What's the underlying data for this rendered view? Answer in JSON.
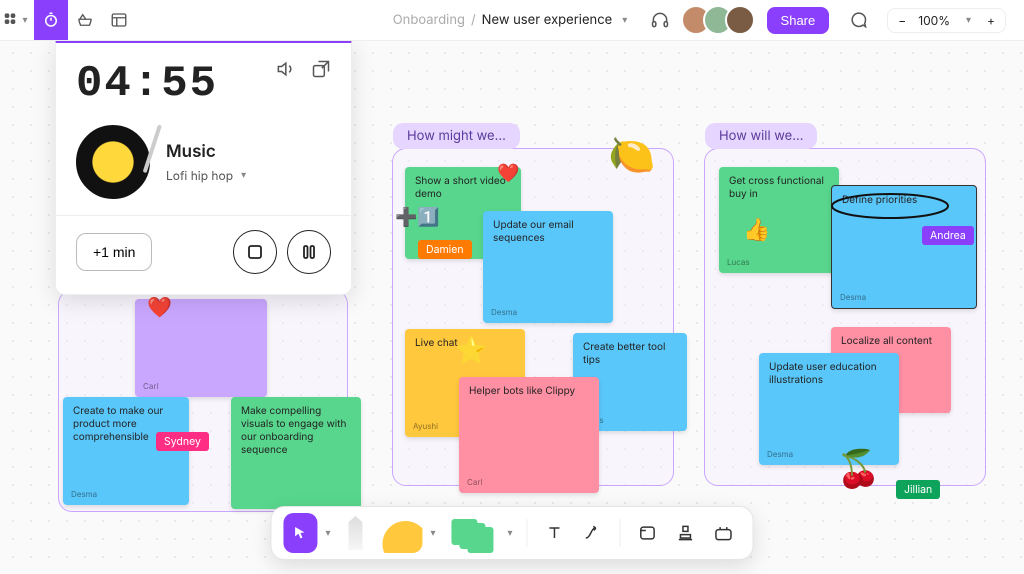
{
  "header": {
    "breadcrumb_parent": "Onboarding",
    "breadcrumb_sep": "/",
    "breadcrumb_title": "New user experience",
    "share_label": "Share",
    "zoom_label": "100%"
  },
  "timer": {
    "digits": "04:55",
    "music_heading": "Music",
    "music_track": "Lofi hip hop",
    "plus_label": "+1 min"
  },
  "sections": [
    {
      "id": "howmight",
      "title": "How might we...",
      "notes": [
        {
          "id": "hm0",
          "text": "Show a short video demo",
          "author": "Damien",
          "color": "#58d68d"
        },
        {
          "id": "hm1",
          "text": "Update our email sequences",
          "author": "Desma",
          "color": "#5ac7fa"
        },
        {
          "id": "hm2",
          "text": "Live chat",
          "author": "Ayushi",
          "color": "#ffc83d"
        },
        {
          "id": "hm3",
          "text": "Create better tool tips",
          "author": "Lucas",
          "color": "#5ac7fa"
        },
        {
          "id": "hm4",
          "text": "Helper bots like Clippy",
          "author": "Carl",
          "color": "#ff8fa3"
        }
      ]
    },
    {
      "id": "howwill",
      "title": "How will we...",
      "notes": [
        {
          "id": "hw0",
          "text": "Get cross functional buy in",
          "author": "Lucas",
          "color": "#58d68d"
        },
        {
          "id": "hw1",
          "text": "Define priorities",
          "author": "Desma",
          "color": "#5ac7fa"
        },
        {
          "id": "hw2",
          "text": "Localize all content",
          "author": "",
          "color": "#ff8fa3"
        },
        {
          "id": "hw3",
          "text": "Update user education illustrations",
          "author": "Desma",
          "color": "#5ac7fa"
        }
      ]
    },
    {
      "id": "left",
      "title": "",
      "notes": [
        {
          "id": "l0",
          "text": "",
          "author": "Carl",
          "color": "#c9a7ff"
        },
        {
          "id": "l1",
          "text": "Create to make our product more comprehensible",
          "author": "Desma",
          "color": "#5ac7fa"
        },
        {
          "id": "l2",
          "text": "Make compelling visuals to engage with our onboarding sequence",
          "author": "",
          "color": "#58d68d"
        }
      ]
    }
  ],
  "cursors": {
    "sydney": "Sydney",
    "damien": "Damien",
    "andrea": "Andrea",
    "jillian": "Jillian"
  }
}
